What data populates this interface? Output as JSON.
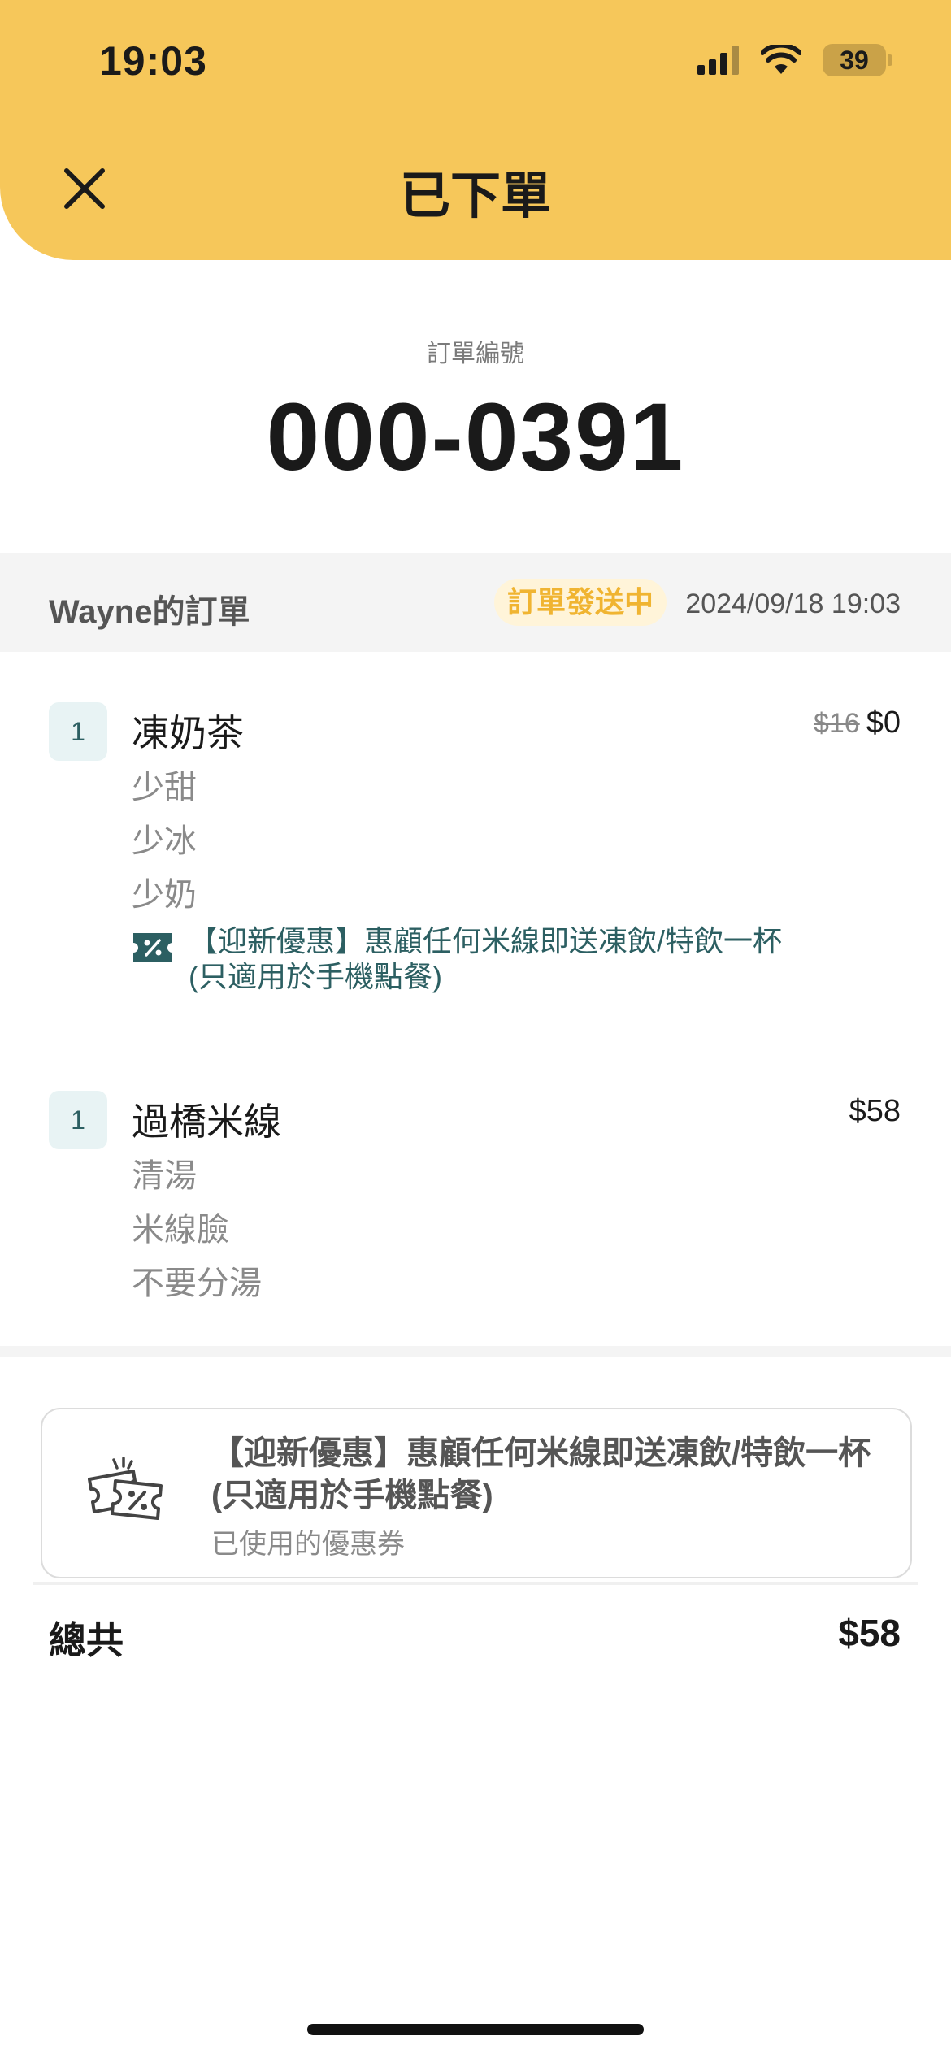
{
  "status_bar": {
    "time": "19:03",
    "battery": "39"
  },
  "header": {
    "title": "已下單"
  },
  "order": {
    "number_label": "訂單編號",
    "number": "000-0391"
  },
  "info_bar": {
    "owner": "Wayne的訂單",
    "status_badge": "訂單發送中",
    "datetime": "2024/09/18 19:03"
  },
  "items": [
    {
      "qty": "1",
      "name": "凍奶茶",
      "original_price": "$16",
      "price": "$0",
      "options": [
        "少甜",
        "少冰",
        "少奶"
      ],
      "promo": "【迎新優惠】惠顧任何米線即送凍飲/特飲一杯(只適用於手機點餐)"
    },
    {
      "qty": "1",
      "name": "過橋米線",
      "price": "$58",
      "options": [
        "清湯",
        "米線臉",
        "不要分湯"
      ]
    }
  ],
  "coupon": {
    "title": "【迎新優惠】惠顧任何米線即送凍飲/特飲一杯(只適用於手機點餐)",
    "subtitle": "已使用的優惠券"
  },
  "total": {
    "label": "總共",
    "value": "$58"
  },
  "colors": {
    "header_bg": "#f6c75a",
    "badge_text": "#f0b431",
    "promo_text": "#2c5f62"
  }
}
